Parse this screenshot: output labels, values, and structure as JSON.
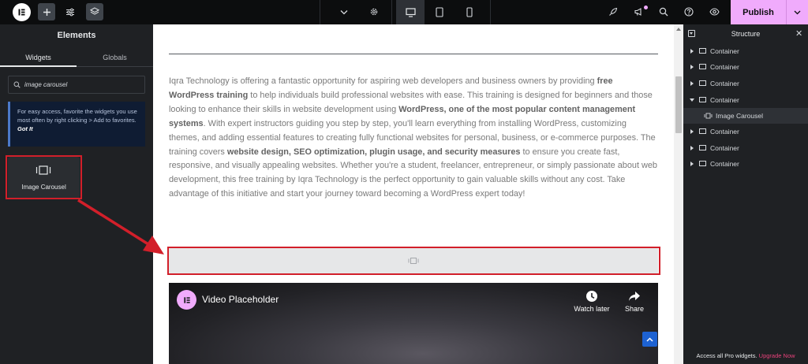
{
  "topbar": {
    "publish_label": "Publish"
  },
  "left_panel": {
    "title": "Elements",
    "tabs": [
      {
        "label": "Widgets"
      },
      {
        "label": "Globals"
      }
    ],
    "search": {
      "value": "image carousel",
      "placeholder": ""
    },
    "info": {
      "text": "For easy access, favorite the widgets you use most often by right clicking > Add to favorites.",
      "link": "Got It"
    },
    "widget": {
      "label": "Image Carousel",
      "icon": "image-carousel-icon"
    }
  },
  "canvas": {
    "paragraph": {
      "p1": "Iqra Technology is offering a fantastic opportunity for aspiring web developers and business owners by providing ",
      "b1": "free WordPress training",
      "p2": " to help individuals build professional websites with ease. This training is designed for beginners and those looking to enhance their skills in website development using ",
      "b2": "WordPress, one of the most popular content management systems",
      "p3": ". With expert instructors guiding you step by step, you'll learn everything from installing WordPress, customizing themes, and adding essential features to creating fully functional websites for personal, business, or e-commerce purposes. The training covers ",
      "b3": "website design, SEO optimization, plugin usage, and security measures",
      "p4": " to ensure you create fast, responsive, and visually appealing websites. Whether you're a student, freelancer, entrepreneur, or simply passionate about web development, this free training by Iqra Technology is the perfect opportunity to gain valuable skills without any cost. Take advantage of this initiative and start your journey toward becoming a WordPress expert today!"
    },
    "video": {
      "title": "Video Placeholder",
      "watch_later": "Watch later",
      "share": "Share"
    }
  },
  "structure": {
    "title": "Structure",
    "items": [
      {
        "label": "Container",
        "expanded": false
      },
      {
        "label": "Container",
        "expanded": false
      },
      {
        "label": "Container",
        "expanded": false
      },
      {
        "label": "Container",
        "expanded": true
      },
      {
        "label": "Image Carousel",
        "child": true
      },
      {
        "label": "Container",
        "expanded": false
      },
      {
        "label": "Container",
        "expanded": false
      },
      {
        "label": "Container",
        "expanded": false
      }
    ],
    "footer_text": "Access all Pro widgets.",
    "footer_link": "Upgrade Now"
  },
  "colors": {
    "accent": "#f0abfc",
    "highlight": "#d21f2a",
    "panel": "#1f2124",
    "topbar": "#0c0d0e"
  }
}
